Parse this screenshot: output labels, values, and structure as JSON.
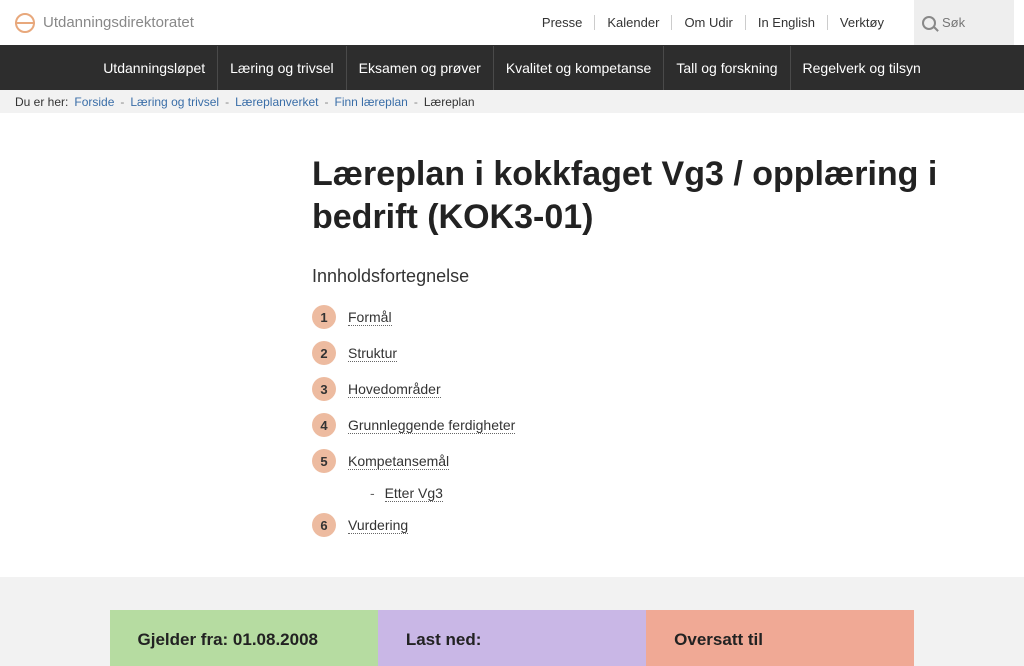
{
  "header": {
    "logo_text": "Utdanningsdirektoratet",
    "links": [
      "Presse",
      "Kalender",
      "Om Udir",
      "In English",
      "Verktøy"
    ],
    "search_placeholder": "Søk"
  },
  "nav": [
    "Utdanningsløpet",
    "Læring og trivsel",
    "Eksamen og prøver",
    "Kvalitet og kompetanse",
    "Tall og forskning",
    "Regelverk og tilsyn"
  ],
  "breadcrumb": {
    "label": "Du er her:",
    "items": [
      "Forside",
      "Læring og trivsel",
      "Læreplanverket",
      "Finn læreplan"
    ],
    "current": "Læreplan"
  },
  "main": {
    "title": "Læreplan i kokkfaget Vg3 / opplæring i bedrift (KOK3-01)",
    "toc_heading": "Innholdsfortegnelse",
    "toc": [
      {
        "n": "1",
        "label": "Formål"
      },
      {
        "n": "2",
        "label": "Struktur"
      },
      {
        "n": "3",
        "label": "Hovedområder"
      },
      {
        "n": "4",
        "label": "Grunnleggende ferdigheter"
      },
      {
        "n": "5",
        "label": "Kompetansemål",
        "sub": "Etter Vg3"
      },
      {
        "n": "6",
        "label": "Vurdering"
      }
    ]
  },
  "info": {
    "col1": "Gjelder fra: 01.08.2008",
    "col2": "Last ned:",
    "col3": "Oversatt til"
  }
}
